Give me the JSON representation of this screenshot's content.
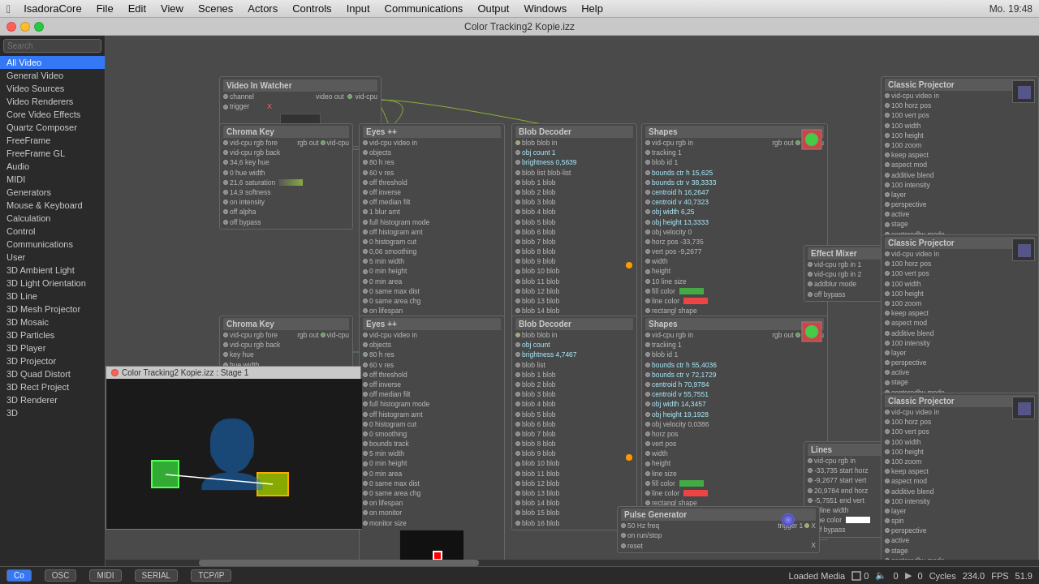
{
  "menubar": {
    "app": "IsadoraCore",
    "items": [
      "File",
      "Edit",
      "View",
      "Scenes",
      "Actors",
      "Controls",
      "Input",
      "Communications",
      "Output",
      "Windows",
      "Help"
    ],
    "right": "Mo. 19:48"
  },
  "titlebar": {
    "title": "Color Tracking2 Kopie.izz"
  },
  "sidebar": {
    "search_placeholder": "Search",
    "items": [
      {
        "label": "All Video",
        "selected": true
      },
      {
        "label": "General Video",
        "selected": false
      },
      {
        "label": "Video Sources",
        "selected": false
      },
      {
        "label": "Video Renderers",
        "selected": false
      },
      {
        "label": "Core Video Effects",
        "selected": false
      },
      {
        "label": "Quartz Composer",
        "selected": false
      },
      {
        "label": "FreeFrame",
        "selected": false
      },
      {
        "label": "FreeFrame GL",
        "selected": false
      },
      {
        "label": "Audio",
        "selected": false
      },
      {
        "label": "MIDI",
        "selected": false
      },
      {
        "label": "Generators",
        "selected": false
      },
      {
        "label": "Mouse & Keyboard",
        "selected": false
      },
      {
        "label": "Calculation",
        "selected": false
      },
      {
        "label": "Control",
        "selected": false
      },
      {
        "label": "Communications",
        "selected": false
      },
      {
        "label": "3D Ambient Light",
        "selected": false
      },
      {
        "label": "3D Light Orientation",
        "selected": false
      },
      {
        "label": "3D Line",
        "selected": false
      },
      {
        "label": "3D Mesh Projector",
        "selected": false
      },
      {
        "label": "3D Mosaic",
        "selected": false
      },
      {
        "label": "3D Particles",
        "selected": false
      },
      {
        "label": "3D Player",
        "selected": false
      },
      {
        "label": "3D Projector",
        "selected": false
      },
      {
        "label": "3D Quad Distort",
        "selected": false
      },
      {
        "label": "3D Rect Project",
        "selected": false
      },
      {
        "label": "3D Renderer",
        "selected": false
      },
      {
        "label": "3D",
        "selected": false
      }
    ]
  },
  "nodes": {
    "video_in_watcher": {
      "title": "Video In Watcher",
      "channel": "channel",
      "vid_out": "video out",
      "trigger": "trigger"
    },
    "chroma_key_1": {
      "title": "Chroma Key"
    },
    "eyes_1": {
      "title": "Eyes ++"
    },
    "blob_decoder_1": {
      "title": "Blob Decoder"
    },
    "shapes_1": {
      "title": "Shapes"
    },
    "effect_mixer": {
      "title": "Effect Mixer"
    },
    "chroma_key_2": {
      "title": "Chroma Key"
    },
    "eyes_2": {
      "title": "Eyes ++"
    },
    "blob_decoder_2": {
      "title": "Blob Decoder"
    },
    "shapes_2": {
      "title": "Shapes"
    },
    "lines": {
      "title": "Lines"
    },
    "pulse_generator": {
      "title": "Pulse Generator"
    },
    "classic_projector_1": {
      "title": "Classic Projector"
    },
    "classic_projector_2": {
      "title": "Classic Projector"
    },
    "classic_projector_3": {
      "title": "Classic Projector"
    }
  },
  "preview": {
    "title": "Color Tracking2 Kopie.izz : Stage 1"
  },
  "statusbar": {
    "tabs": [
      "OSC",
      "MIDI",
      "SERIAL",
      "TCP/IP"
    ],
    "active_tab": "Co",
    "loaded_media": "Loaded Media",
    "loaded_count": "0",
    "cycles_label": "Cycles",
    "cycles_value": "234.0",
    "fps_label": "FPS",
    "fps_value": "51.9"
  }
}
